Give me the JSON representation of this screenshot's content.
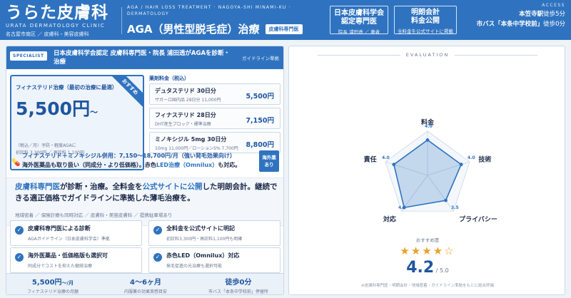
{
  "header": {
    "logo_main": "うらた皮膚科",
    "logo_en": "URATA DERMATOLOGY CLINIC",
    "logo_sub": "名古屋市南区 ／ 皮膚科・美容皮膚科",
    "tagline_en": "AGA / HAIR LOSS TREATMENT · NAGOYA-SHI MINAMI-KU · DERMATOLOGY",
    "hero_title": "AGA（男性型脱毛症）治療",
    "hero_tag": "皮膚科専門医",
    "box1_title_1": "日本皮膚科学会",
    "box1_title_2": "認定専門医",
    "box1_sub": "院長 浦田透 ／ 著者",
    "box2_title_1": "明朗会計",
    "box2_title_2": "料金公開",
    "box2_sub": "全料金を公式サイトに掲載",
    "access_label": "ACCESS",
    "access_line1_bold": "本笠寺駅",
    "access_line1_rest": "徒歩5分",
    "access_line2_bold": "市バス「本条中学校前」",
    "access_line2_rest": "徒歩0分"
  },
  "spec": {
    "badge": "SPECIALIST",
    "text": "日本皮膚科学会認定 皮膚科専門医・院長 浦田透がAGAを診断・治療",
    "note": "ガイドライン準拠"
  },
  "recommend": {
    "corner": "おすすめ",
    "title": "フィナステリド治療（最初の治療に最適）",
    "price": "5,500円",
    "price_suffix": "〜",
    "small_1": "（税込／月）予防・軽度AGAに",
    "small_2": "初診料 3,300円 ／ 再診料 1,100円"
  },
  "fees": {
    "label": "薬剤料金（税込）",
    "items": [
      {
        "name": "デュタステリド 30日分",
        "desc": "ザガーロ国内品 28日分 11,000円",
        "price": "5,500円"
      },
      {
        "name": "フィナステリド 28日分",
        "desc": "DHT産生ブロック・標準治療",
        "price": "7,150円"
      },
      {
        "name": "ミノキシジル 5mg 30日分",
        "desc": "10mg 11,000円／ローション5% 7,700円",
        "price": "8,800円"
      }
    ]
  },
  "combo": {
    "line1": "フィナステリド＋ミノキシジル併用：7,150〜18,700円/月（強い発毛効果向け）",
    "line2_pre": "海外医薬品も取り扱い（同成分・より低価格）。赤色",
    "line2_hl": "LED治療（Omnilux）",
    "line2_post": "も対応。",
    "badge_1": "海外薬",
    "badge_2": "あり"
  },
  "summary": {
    "p1": "皮膚科専門医",
    "p2": "が診断・治療。全料金を",
    "p3": "公式サイトに公開",
    "p4": "した明朗会計。継続できる適正価格でガイドラインに準拠した薄毛治療を。",
    "sub": "地域密着 ／ 保険診療も同時対応 ／ 皮膚科・美容皮膚科 ／ 提携駐車場あり"
  },
  "checks": [
    {
      "head": "皮膚科専門医による診断",
      "sub": "AGAガイドライン（日本皮膚科学会）準拠"
    },
    {
      "head": "全料金を公式サイトに明記",
      "sub": "初診料3,300円・再診料1,100円も明確"
    },
    {
      "head": "海外医薬品・低価格版も選択可",
      "sub": "同成分でコストを抑えた継続治療"
    },
    {
      "head": "赤色LED（Omnilux）対応",
      "sub": "発毛促進の光治療も選択可能"
    }
  ],
  "stats": [
    {
      "value": "5,500円",
      "unit": "〜/月",
      "label": "フィナステリド治療の月額"
    },
    {
      "value": "4〜6ヶ月",
      "unit": "",
      "label": "内服薬の効果実感目安"
    },
    {
      "value": "徒歩0分",
      "unit": "",
      "label": "市バス「本条中学校前」停留所"
    }
  ],
  "evaluation": {
    "title": "EVALUATION",
    "recommend_label": "おすすめ度",
    "stars": "★★★★☆",
    "score": "4.2",
    "score_max": " / 5.0",
    "note": "※皮膚科専門医・明朗会計・地域密着・ガイドライン準拠をもとに総合評価"
  },
  "chart_data": {
    "type": "radar",
    "axes": [
      "料金",
      "技術",
      "プライバシー",
      "対応",
      "責任"
    ],
    "values": [
      4.0,
      4.0,
      3.5,
      4.5,
      4.0
    ],
    "value_labels": [
      "4.0",
      "4.0",
      "3.5",
      "4.5",
      "4.0"
    ],
    "range": [
      0,
      5
    ],
    "accent": "#2f73c0"
  }
}
